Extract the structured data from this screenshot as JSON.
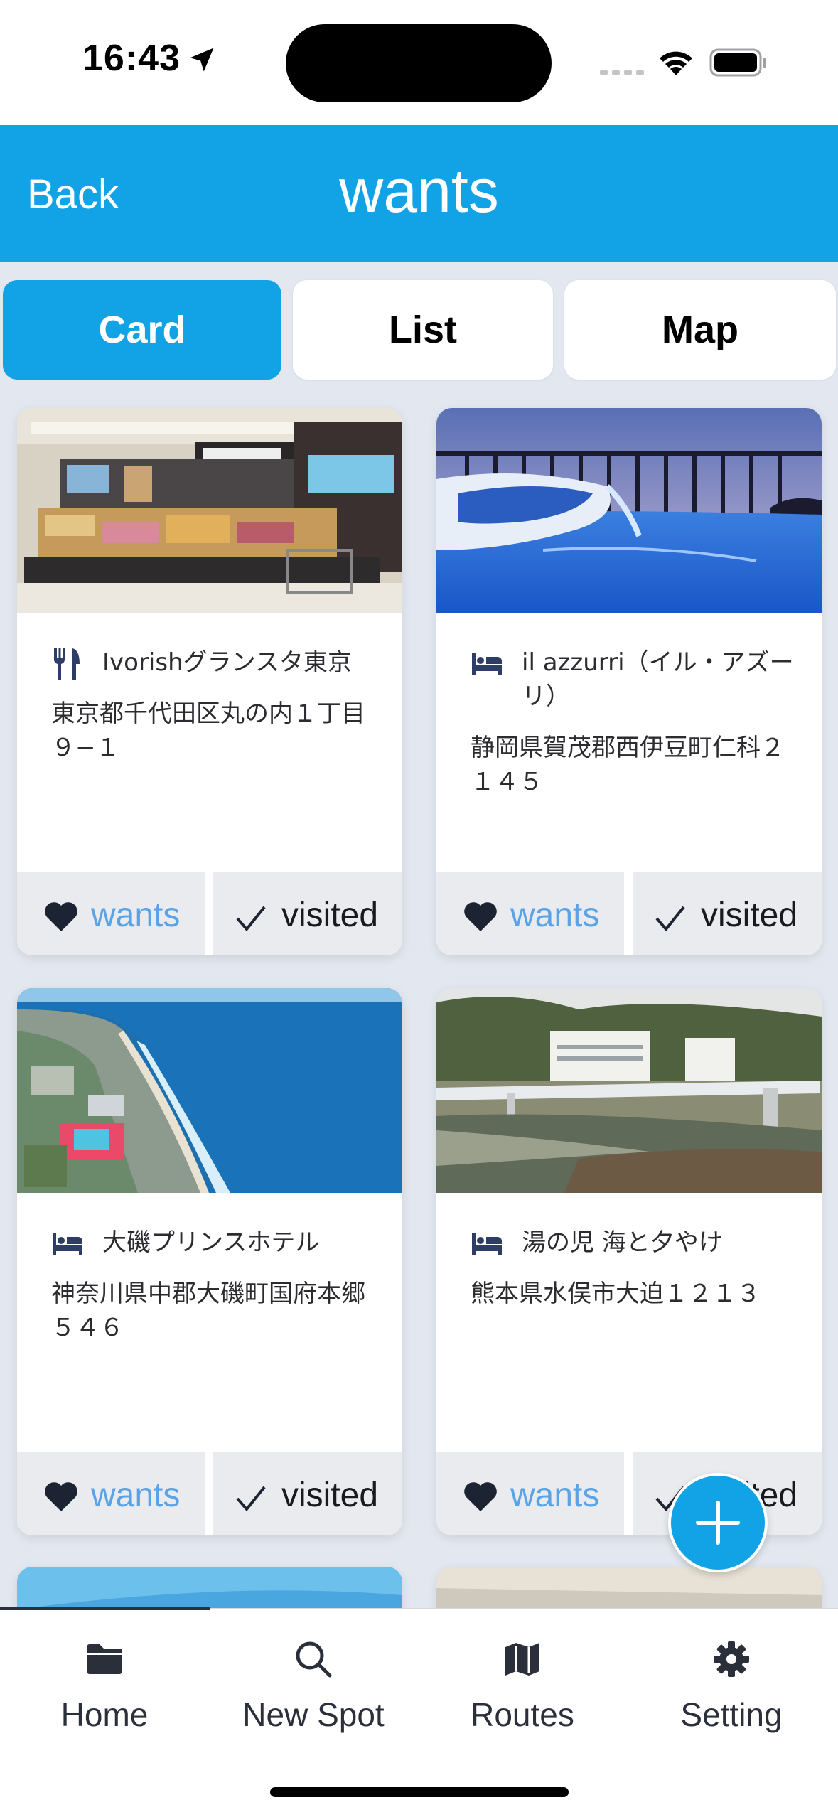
{
  "status_bar": {
    "time": "16:43"
  },
  "nav": {
    "back_label": "Back",
    "title": "wants"
  },
  "tabs": [
    {
      "label": "Card",
      "active": true
    },
    {
      "label": "List",
      "active": false
    },
    {
      "label": "Map",
      "active": false
    }
  ],
  "spots": [
    {
      "category_icon": "restaurant-icon",
      "name": "Ivorishグランスタ東京",
      "address": "東京都千代田区丸の内１丁目９−１",
      "wants_label": "wants",
      "visited_label": "visited"
    },
    {
      "category_icon": "hotel-icon",
      "name": "il azzurri（イル・アズーリ）",
      "address": "静岡県賀茂郡西伊豆町仁科２１４５",
      "wants_label": "wants",
      "visited_label": "visited"
    },
    {
      "category_icon": "hotel-icon",
      "name": "大磯プリンスホテル",
      "address": "神奈川県中郡大磯町国府本郷５４６",
      "wants_label": "wants",
      "visited_label": "visited"
    },
    {
      "category_icon": "hotel-icon",
      "name": "湯の児 海と夕やけ",
      "address": "熊本県水俣市大迫１２１３",
      "wants_label": "wants",
      "visited_label": "visited"
    }
  ],
  "tab_bar": [
    {
      "label": "Home",
      "icon": "folder-icon"
    },
    {
      "label": "New Spot",
      "icon": "search-icon"
    },
    {
      "label": "Routes",
      "icon": "map-icon"
    },
    {
      "label": "Setting",
      "icon": "gear-icon"
    }
  ],
  "colors": {
    "accent": "#11a3e6",
    "background": "#e3e8f0",
    "wants_text": "#5aa3e6",
    "icon": "#2b2f3a"
  }
}
